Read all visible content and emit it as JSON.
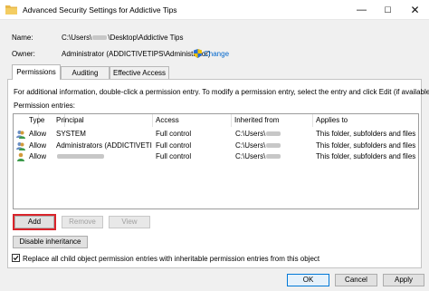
{
  "window": {
    "title": "Advanced Security Settings for Addictive Tips",
    "min_glyph": "—",
    "max_glyph": "☐",
    "close_glyph": "✕"
  },
  "name_label": "Name:",
  "name_value_prefix": "C:\\Users\\",
  "name_value_suffix": "\\Desktop\\Addictive Tips",
  "owner_label": "Owner:",
  "owner_value": "Administrator (ADDICTIVETIPS\\Administrator)",
  "owner_change_link": "Change",
  "tabs": [
    {
      "label": "Permissions",
      "active": true
    },
    {
      "label": "Auditing",
      "active": false
    },
    {
      "label": "Effective Access",
      "active": false
    }
  ],
  "info_text": "For additional information, double-click a permission entry. To modify a permission entry, select the entry and click Edit (if available).",
  "permission_entries_label": "Permission entries:",
  "columns": {
    "type": "Type",
    "principal": "Principal",
    "access": "Access",
    "inherited_from": "Inherited from",
    "applies_to": "Applies to"
  },
  "rows": [
    {
      "icon": "users-icon",
      "type": "Allow",
      "principal": "SYSTEM",
      "access": "Full control",
      "inherited_from": "C:\\Users\\",
      "applies_to": "This folder, subfolders and files"
    },
    {
      "icon": "users-icon",
      "type": "Allow",
      "principal": "Administrators (ADDICTIVETIPS\\Ad...",
      "access": "Full control",
      "inherited_from": "C:\\Users\\",
      "applies_to": "This folder, subfolders and files"
    },
    {
      "icon": "user-icon",
      "type": "Allow",
      "principal": "",
      "access": "Full control",
      "inherited_from": "C:\\Users\\",
      "applies_to": "This folder, subfolders and files"
    }
  ],
  "buttons": {
    "add": "Add",
    "remove": "Remove",
    "view": "View",
    "disable_inheritance": "Disable inheritance",
    "ok": "OK",
    "cancel": "Cancel",
    "apply": "Apply"
  },
  "replace_checkbox": {
    "label": "Replace all child object permission entries with inheritable permission entries from this object",
    "checked": true
  },
  "colors": {
    "accent_link": "#0066cc",
    "highlight": "#d9242b",
    "ok_border": "#0078d7"
  }
}
